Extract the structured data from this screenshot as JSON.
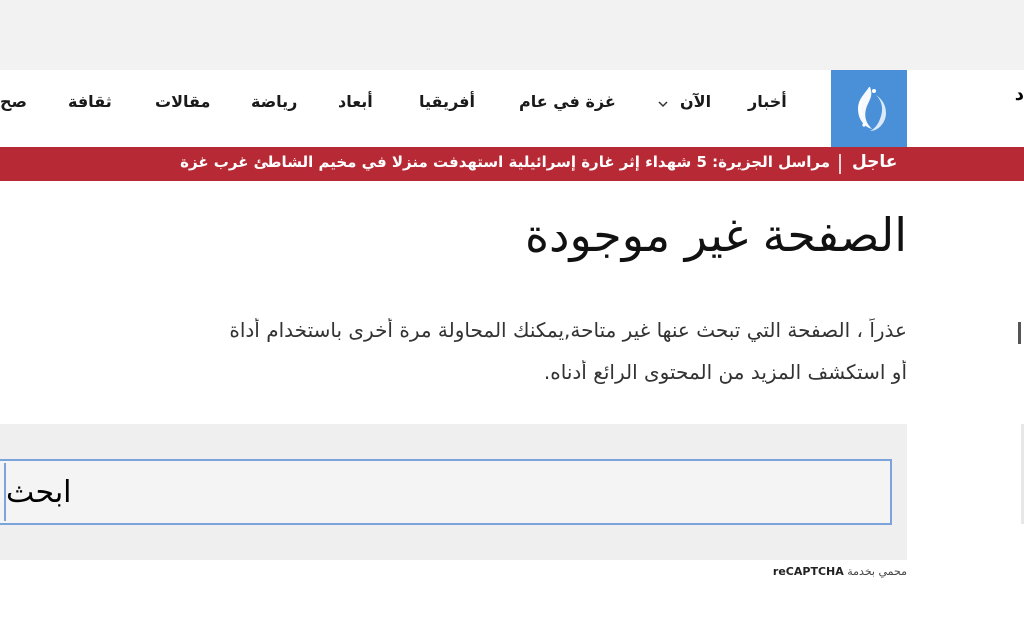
{
  "header": {
    "logo_name": "al-jazeera-logo",
    "nav": [
      {
        "label": "أخبار"
      },
      {
        "label": "الآن"
      },
      {
        "label": "غزة في عام"
      },
      {
        "label": "أفريقيا"
      },
      {
        "label": "أبعاد"
      },
      {
        "label": "رياضة"
      },
      {
        "label": "مقالات"
      },
      {
        "label": "ثقافة"
      },
      {
        "label": "صح"
      }
    ],
    "right_cut": "د"
  },
  "breaking": {
    "label": "عاجل",
    "text": "مراسل الجزيرة: 5 شهداء إثر غارة إسرائيلية استهدفت منزلا في مخيم الشاطئ غرب غزة"
  },
  "main": {
    "title": "الصفحة غير موجودة",
    "message_line1": "عذراً ، الصفحة التي تبحث عنها غير متاحة,يمكنك المحاولة مرة أخرى باستخدام أداة",
    "message_line2": "أو استكشف المزيد من المحتوى الرائع أدناه."
  },
  "search": {
    "value": "ابحث",
    "recaptcha_prefix": "محمي بخدمة",
    "recaptcha_brand": "reCAPTCHA"
  },
  "colors": {
    "breaking_bg": "#b72a35",
    "logo_bg": "#4a90d9",
    "focus_border": "#7ba3dc"
  }
}
